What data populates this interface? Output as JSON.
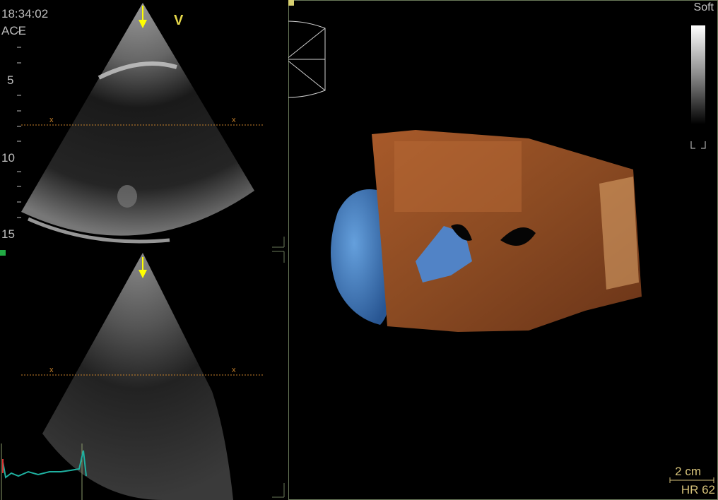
{
  "header": {
    "time": "18:34:02",
    "preset": "ACE",
    "view_letter": "V"
  },
  "depth_scale": {
    "labels": [
      "5",
      "10",
      "15"
    ]
  },
  "render_panel": {
    "colormap_label": "Soft",
    "scale_bar_label": "2 cm",
    "heart_rate": "HR 62"
  },
  "colors": {
    "marker": "#ffff00",
    "orange_guide": "#c8822a",
    "frame": "#6a7a5a",
    "ecg": "#1fb0a0",
    "scale_text": "#d6c27a"
  },
  "icons": [
    "down-arrow-icon",
    "orientation-cube-icon",
    "colormap-gradient-icon",
    "scale-bar-icon"
  ]
}
